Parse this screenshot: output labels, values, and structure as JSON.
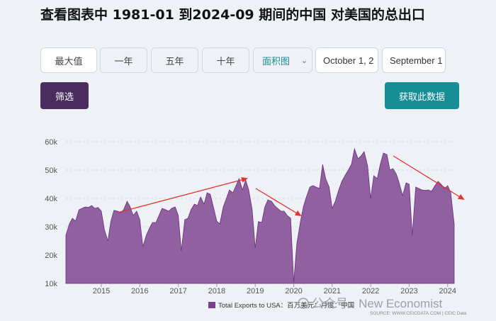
{
  "title": "查看图表中 1981-01 到2024-09 期间的中国 对美国的总出口",
  "controls": {
    "max": "最大值",
    "y1": "一年",
    "y5": "五年",
    "y10": "十年",
    "chart_type": "面积图",
    "date_from": "October 1, 2",
    "date_to": "September 1",
    "filter": "筛选",
    "get_data": "获取此数据"
  },
  "legend": "Total Exports to USA：百万美元：月度：中国",
  "source": "SOURCE: WWW.CEICDATA.COM | CEIC Data",
  "watermark": "公众号 · New Economist",
  "colors": {
    "area": "#7b3f8c",
    "accent": "#178e94",
    "trend_arrow": "#e6322d"
  },
  "chart_data": {
    "type": "area",
    "title": "",
    "xlabel": "",
    "ylabel": "",
    "x_tick_labels": [
      "2015",
      "2016",
      "2017",
      "2018",
      "2019",
      "2020",
      "2021",
      "2022",
      "2023",
      "2024"
    ],
    "y_tick_labels": [
      "10k",
      "20k",
      "30k",
      "40k",
      "50k",
      "60k"
    ],
    "ylim": [
      10000,
      60000
    ],
    "xlim": [
      2014.08,
      2024.17
    ],
    "grid": true,
    "series": [
      {
        "name": "Total Exports to USA",
        "points": [
          [
            2014.08,
            27000
          ],
          [
            2014.17,
            31000
          ],
          [
            2014.25,
            33000
          ],
          [
            2014.33,
            32000
          ],
          [
            2014.42,
            36000
          ],
          [
            2014.5,
            36500
          ],
          [
            2014.58,
            37000
          ],
          [
            2014.67,
            36800
          ],
          [
            2014.75,
            37500
          ],
          [
            2014.83,
            36500
          ],
          [
            2014.92,
            36800
          ],
          [
            2015.0,
            35500
          ],
          [
            2015.08,
            29000
          ],
          [
            2015.17,
            25000
          ],
          [
            2015.25,
            32000
          ],
          [
            2015.33,
            35800
          ],
          [
            2015.42,
            35500
          ],
          [
            2015.5,
            35000
          ],
          [
            2015.58,
            36000
          ],
          [
            2015.67,
            39000
          ],
          [
            2015.75,
            37000
          ],
          [
            2015.83,
            34000
          ],
          [
            2015.92,
            35500
          ],
          [
            2016.0,
            32500
          ],
          [
            2016.08,
            23000
          ],
          [
            2016.17,
            27000
          ],
          [
            2016.25,
            29500
          ],
          [
            2016.33,
            31500
          ],
          [
            2016.42,
            31500
          ],
          [
            2016.5,
            34000
          ],
          [
            2016.58,
            36500
          ],
          [
            2016.67,
            36000
          ],
          [
            2016.75,
            35500
          ],
          [
            2016.83,
            36500
          ],
          [
            2016.92,
            37000
          ],
          [
            2017.0,
            34000
          ],
          [
            2017.08,
            21500
          ],
          [
            2017.17,
            32500
          ],
          [
            2017.25,
            33000
          ],
          [
            2017.33,
            36000
          ],
          [
            2017.42,
            38000
          ],
          [
            2017.5,
            37500
          ],
          [
            2017.58,
            40500
          ],
          [
            2017.67,
            38000
          ],
          [
            2017.75,
            42000
          ],
          [
            2017.83,
            41500
          ],
          [
            2017.92,
            36500
          ],
          [
            2018.0,
            32000
          ],
          [
            2018.08,
            31000
          ],
          [
            2018.17,
            37000
          ],
          [
            2018.25,
            40000
          ],
          [
            2018.33,
            43000
          ],
          [
            2018.42,
            42000
          ],
          [
            2018.5,
            44500
          ],
          [
            2018.58,
            47000
          ],
          [
            2018.67,
            43000
          ],
          [
            2018.75,
            46500
          ],
          [
            2018.83,
            43000
          ],
          [
            2018.92,
            36000
          ],
          [
            2019.0,
            22500
          ],
          [
            2019.08,
            31800
          ],
          [
            2019.17,
            31500
          ],
          [
            2019.25,
            37000
          ],
          [
            2019.33,
            39500
          ],
          [
            2019.42,
            39000
          ],
          [
            2019.5,
            37500
          ],
          [
            2019.58,
            36500
          ],
          [
            2019.67,
            35500
          ],
          [
            2019.75,
            35500
          ],
          [
            2019.83,
            34000
          ],
          [
            2019.92,
            33000
          ],
          [
            2020.0,
            10500
          ],
          [
            2020.08,
            24000
          ],
          [
            2020.17,
            31500
          ],
          [
            2020.25,
            37000
          ],
          [
            2020.33,
            40500
          ],
          [
            2020.42,
            44000
          ],
          [
            2020.5,
            44500
          ],
          [
            2020.58,
            44000
          ],
          [
            2020.67,
            43500
          ],
          [
            2020.75,
            52000
          ],
          [
            2020.83,
            47000
          ],
          [
            2020.92,
            44000
          ],
          [
            2021.0,
            36500
          ],
          [
            2021.08,
            39000
          ],
          [
            2021.17,
            43000
          ],
          [
            2021.25,
            46000
          ],
          [
            2021.33,
            48000
          ],
          [
            2021.42,
            50000
          ],
          [
            2021.5,
            52000
          ],
          [
            2021.58,
            57500
          ],
          [
            2021.67,
            54000
          ],
          [
            2021.75,
            55000
          ],
          [
            2021.83,
            56500
          ],
          [
            2021.92,
            51500
          ],
          [
            2022.0,
            40000
          ],
          [
            2022.08,
            48000
          ],
          [
            2022.17,
            47000
          ],
          [
            2022.25,
            52000
          ],
          [
            2022.33,
            56000
          ],
          [
            2022.42,
            55500
          ],
          [
            2022.5,
            50000
          ],
          [
            2022.58,
            50500
          ],
          [
            2022.67,
            48500
          ],
          [
            2022.75,
            45000
          ],
          [
            2022.83,
            41000
          ],
          [
            2022.92,
            45500
          ],
          [
            2023.0,
            45000
          ],
          [
            2023.08,
            27000
          ],
          [
            2023.17,
            44000
          ],
          [
            2023.25,
            43500
          ],
          [
            2023.33,
            43000
          ],
          [
            2023.42,
            42800
          ],
          [
            2023.5,
            43000
          ],
          [
            2023.58,
            42500
          ],
          [
            2023.67,
            44500
          ],
          [
            2023.75,
            46000
          ],
          [
            2023.83,
            45000
          ],
          [
            2023.92,
            43500
          ],
          [
            2024.0,
            44500
          ],
          [
            2024.08,
            42000
          ],
          [
            2024.17,
            31000
          ]
        ]
      }
    ]
  }
}
